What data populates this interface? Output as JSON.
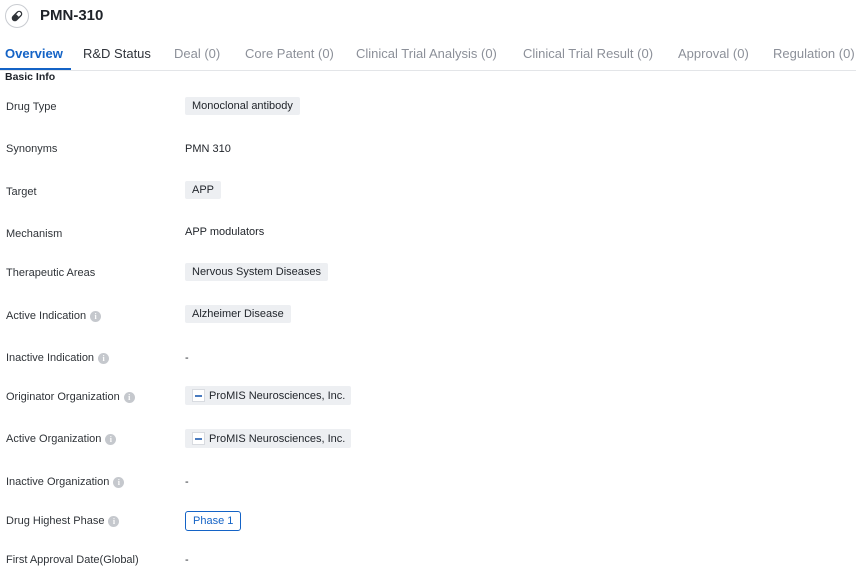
{
  "header": {
    "title": "PMN-310",
    "icon": "pill-icon"
  },
  "tabs": [
    {
      "label": "Overview",
      "state": "active"
    },
    {
      "label": "R&D Status",
      "state": "enabled"
    },
    {
      "label": "Deal (0)",
      "state": "disabled"
    },
    {
      "label": "Core Patent (0)",
      "state": "disabled"
    },
    {
      "label": "Clinical Trial Analysis (0)",
      "state": "disabled"
    },
    {
      "label": "Clinical Trial Result (0)",
      "state": "disabled"
    },
    {
      "label": "Approval (0)",
      "state": "disabled"
    },
    {
      "label": "Regulation (0)",
      "state": "disabled"
    }
  ],
  "section_title": "Basic Info",
  "rows": {
    "drug_type": {
      "label": "Drug Type",
      "value": "Monoclonal antibody"
    },
    "synonyms": {
      "label": "Synonyms",
      "value": "PMN 310"
    },
    "target": {
      "label": "Target",
      "value": "APP"
    },
    "mechanism": {
      "label": "Mechanism",
      "value": "APP modulators"
    },
    "therapeutic_areas": {
      "label": "Therapeutic Areas",
      "value": "Nervous System Diseases"
    },
    "active_indication": {
      "label": "Active Indication",
      "value": "Alzheimer Disease"
    },
    "inactive_indication": {
      "label": "Inactive Indication",
      "value": "-"
    },
    "originator_org": {
      "label": "Originator Organization",
      "value": "ProMIS Neurosciences, Inc."
    },
    "active_org": {
      "label": "Active Organization",
      "value": "ProMIS Neurosciences, Inc."
    },
    "inactive_org": {
      "label": "Inactive Organization",
      "value": "-"
    },
    "highest_phase": {
      "label": "Drug Highest Phase",
      "value": "Phase 1"
    },
    "first_approval": {
      "label": "First Approval Date(Global)",
      "value": "-"
    }
  },
  "colors": {
    "accent": "#1463c6",
    "tag_bg": "#edeff2",
    "muted_tab": "#8c9099"
  }
}
